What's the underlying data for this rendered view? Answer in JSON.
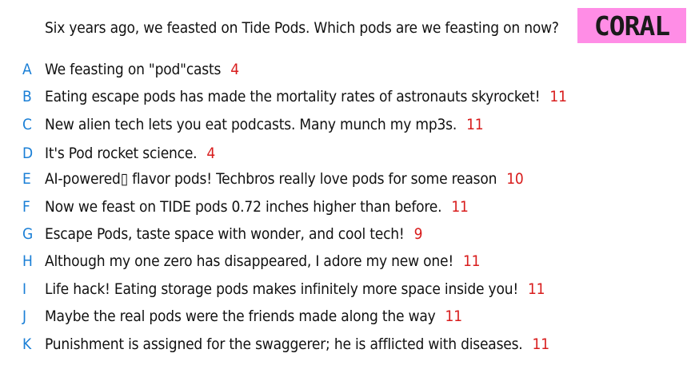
{
  "question": "Six years ago, we feasted on Tide Pods. Which pods are we feasting on now?",
  "team_badge": {
    "label": "CORAL",
    "background": "#ff8de6"
  },
  "colors": {
    "letter": "#1a7fd6",
    "score": "#d81c1c",
    "text": "#111111"
  },
  "answers": [
    {
      "letter": "A",
      "text": "We feasting on \"pod\"casts",
      "score": "4"
    },
    {
      "letter": "B",
      "text": "Eating escape pods has made the mortality rates of astronauts skyrocket!",
      "score": "11"
    },
    {
      "letter": "C",
      "text": "New alien tech lets you eat podcasts. Many munch my mp3s.",
      "score": "11"
    },
    {
      "letter": "D",
      "text": "It's Pod rocket science.",
      "score": "4"
    },
    {
      "letter": "E",
      "text": "AI-powered▯ flavor pods! Techbros really love pods for some reason",
      "score": "10"
    },
    {
      "letter": "F",
      "text": "Now we feast on TIDE pods 0.72 inches higher than before.",
      "score": "11"
    },
    {
      "letter": "G",
      "text": "Escape Pods, taste space with wonder, and cool tech!",
      "score": "9"
    },
    {
      "letter": "H",
      "text": "Although my one zero has disappeared, I adore my new one!",
      "score": "11"
    },
    {
      "letter": "I",
      "text": "Life hack! Eating storage pods makes infinitely more space inside you!",
      "score": "11"
    },
    {
      "letter": "J",
      "text": "Maybe the real pods were the friends made along the way",
      "score": "11"
    },
    {
      "letter": "K",
      "text": "Punishment is assigned for the swaggerer; he is afflicted with diseases.",
      "score": "11"
    }
  ]
}
